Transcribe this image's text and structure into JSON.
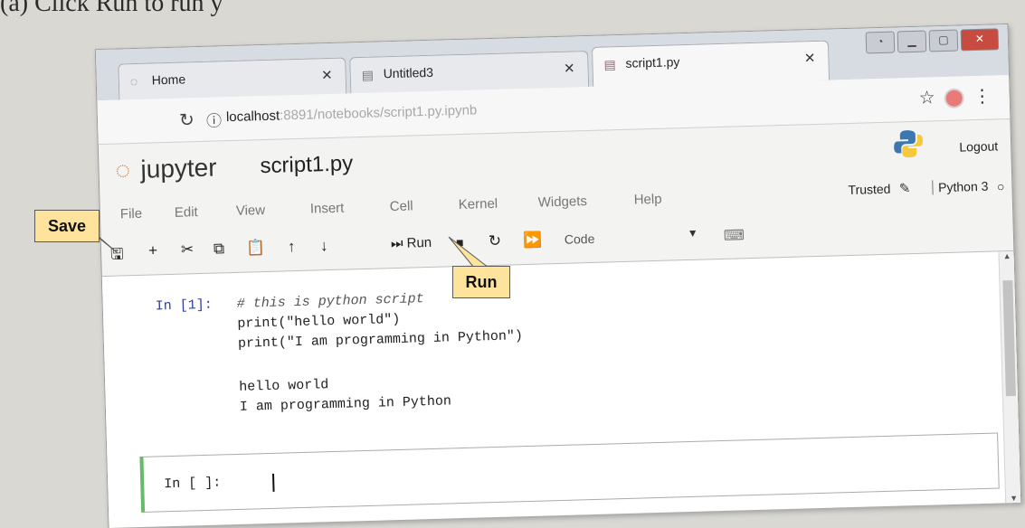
{
  "caption": "(a) Click Run to run y",
  "browser": {
    "tabs": [
      {
        "label": "Home",
        "icon": "jupyter-tab-icon"
      },
      {
        "label": "Untitled3",
        "icon": "notebook-tab-icon"
      },
      {
        "label": "script1.py",
        "icon": "notebook-tab-icon"
      }
    ],
    "url_host": "localhost",
    "url_rest": ":8891/notebooks/script1.py.ipynb"
  },
  "jupyter": {
    "logo_text": "jupyter",
    "notebook_title": "script1.py",
    "logout": "Logout",
    "menu": [
      "File",
      "Edit",
      "View",
      "Insert",
      "Cell",
      "Kernel",
      "Widgets",
      "Help"
    ],
    "trusted": "Trusted",
    "kernel": "Python 3",
    "toolbar": {
      "run_label": "Run",
      "cell_type": "Code"
    }
  },
  "cells": [
    {
      "prompt": "In [1]:",
      "comment": "# this is python script",
      "code": [
        "print(\"hello world\")",
        "print(\"I am programming in Python\")"
      ],
      "output": [
        "hello world",
        "I am programming in Python"
      ]
    },
    {
      "prompt": "In [ ]:"
    }
  ],
  "callouts": {
    "save": "Save",
    "run": "Run"
  },
  "colors": {
    "accent_orange": "#f37726",
    "callout_bg": "#fde39b",
    "active_cell": "#66bb6a"
  }
}
